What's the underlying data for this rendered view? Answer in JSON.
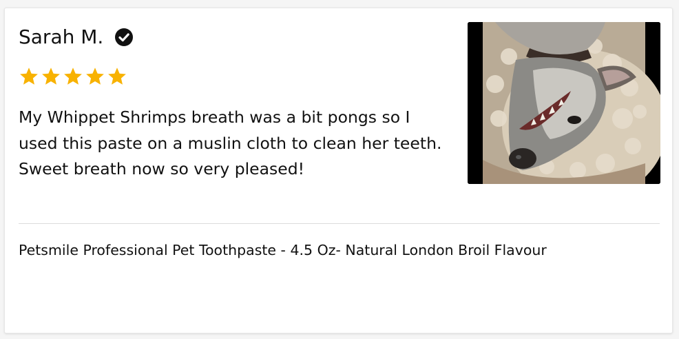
{
  "review": {
    "reviewer_name": "Sarah M.",
    "verified_icon": "check-circle-icon",
    "rating": 5,
    "rating_max": 5,
    "star_color": "#F8B200",
    "text": "My Whippet Shrimps breath was a bit pongs so I used this paste on a muslin cloth to clean her teeth. Sweet breath now so very pleased!",
    "photo_subject": "whippet-dog-photo",
    "product_name": "Petsmile Professional Pet Toothpaste - 4.5 Oz- Natural London Broil Flavour"
  }
}
